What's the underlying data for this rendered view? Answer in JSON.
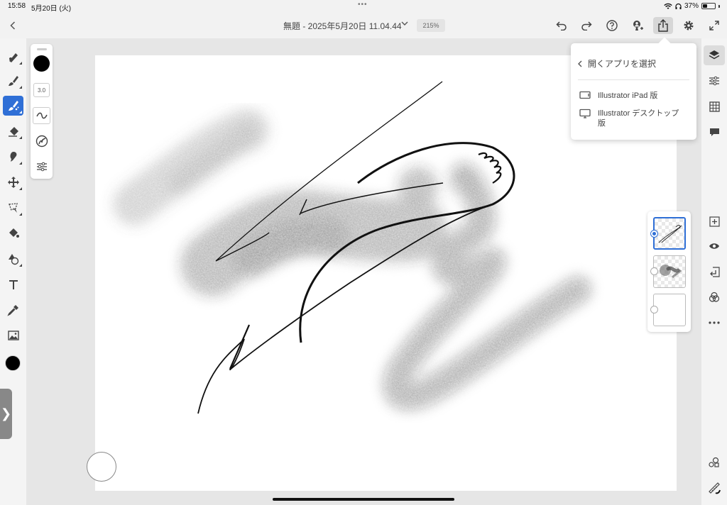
{
  "status": {
    "time": "15:58",
    "date": "5月20日 (火)",
    "battery": "37%",
    "battery_level": 0.37
  },
  "header": {
    "title": "無題 - 2025年5月20日 11.04.44",
    "zoom": "215%"
  },
  "brush": {
    "size": "3.0",
    "color": "#000000"
  },
  "export_menu": {
    "header": "開くアプリを選択",
    "items": [
      {
        "label": "Illustrator iPad 版",
        "icon": "tablet-icon"
      },
      {
        "label": "Illustrator デスクトップ版",
        "icon": "desktop-icon"
      }
    ]
  },
  "colors": {
    "accent": "#2f6fd6",
    "toolbar_bg": "#f2f2f2",
    "canvas_bg": "#ffffff"
  },
  "side_tab": {
    "glyph": "❯"
  }
}
